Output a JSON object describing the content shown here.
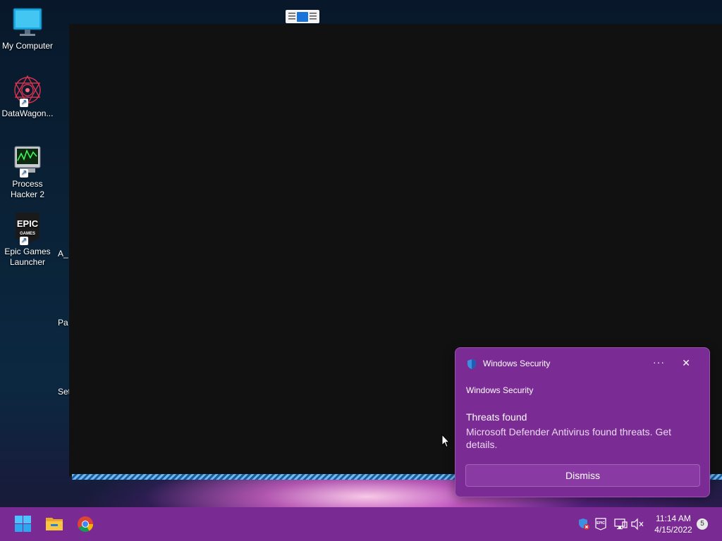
{
  "desktop": {
    "icons": [
      {
        "label": "My Computer"
      },
      {
        "label": "DataWagon..."
      },
      {
        "label": "Process Hacker 2"
      },
      {
        "label": "Epic Games Launcher"
      }
    ],
    "partial_labels": [
      "A_",
      "Pa",
      "Set"
    ]
  },
  "toast": {
    "app_name": "Windows Security",
    "more_glyph": "···",
    "close_glyph": "✕",
    "subtitle": "Windows Security",
    "title": "Threats found",
    "message": "Microsoft Defender Antivirus found threats. Get details.",
    "dismiss_label": "Dismiss"
  },
  "taskbar": {
    "pinned": [
      "start-icon",
      "file-explorer-icon",
      "chrome-icon"
    ],
    "tray_icons": [
      "defender-icon",
      "epic-games-tray-icon",
      "network-icon",
      "volume-muted-icon"
    ],
    "time": "11:14 AM",
    "date": "4/15/2022",
    "notification_count": "5"
  },
  "colors": {
    "taskbar": "#7a2a93",
    "toast_bg": "#7a2b94",
    "window_bg": "#111111",
    "progress": "#6fb7ef"
  }
}
